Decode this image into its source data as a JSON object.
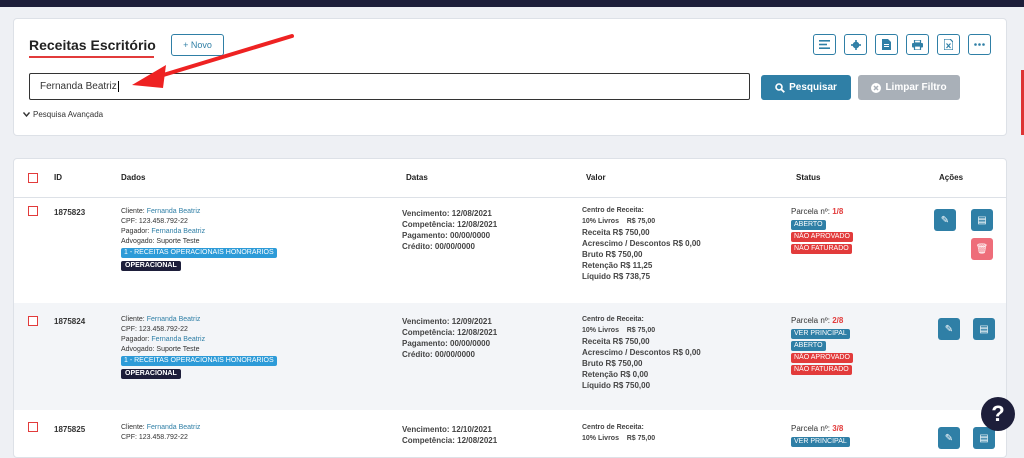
{
  "header": {
    "title": "Receitas Escritório",
    "new_button": "+ Novo",
    "toolbar_icons": [
      "list-icon",
      "gear-icon",
      "document-icon",
      "print-icon",
      "excel-icon",
      "more-icon"
    ]
  },
  "search": {
    "value": "Fernanda Beatriz",
    "search_button": "Pesquisar",
    "clear_button": "Limpar Filtro",
    "advanced_label": "Pesquisa Avançada"
  },
  "table": {
    "columns": {
      "id": "ID",
      "dados": "Dados",
      "datas": "Datas",
      "valor": "Valor",
      "status": "Status",
      "acoes": "Ações"
    },
    "rows": [
      {
        "id": "1875823",
        "cliente_label": "Cliente:",
        "cliente": "Fernanda Beatriz",
        "cpf": "CPF: 123.458.792-22",
        "pagador_label": "Pagador:",
        "pagador": "Fernanda Beatriz",
        "advogado": "Advogado: Suporte Teste",
        "categoria": "1 - RECEITAS OPERACIONAIS HONORARIOS",
        "tipo": "OPERACIONAL",
        "vencimento": "Vencimento: 12/08/2021",
        "competencia": "Competência: 12/08/2021",
        "pagamento": "Pagamento: 00/00/0000",
        "credito": "Crédito: 00/00/0000",
        "centro": "Centro de Receita:",
        "centro_item": "10% Livros    R$ 75,00",
        "receita": "Receita R$ 750,00",
        "acrescimo": "Acrescimo / Descontos R$ 0,00",
        "bruto": "Bruto R$ 750,00",
        "retencao": "Retenção R$ 11,25",
        "liquido": "Líquido R$ 738,75",
        "parcela_label": "Parcela nº:",
        "parcela": "1/8",
        "statuses": [
          "ABERTO",
          "NÃO APROVADO",
          "NÃO FATURADO"
        ]
      },
      {
        "id": "1875824",
        "cliente_label": "Cliente:",
        "cliente": "Fernanda Beatriz",
        "cpf": "CPF: 123.458.792-22",
        "pagador_label": "Pagador:",
        "pagador": "Fernanda Beatriz",
        "advogado": "Advogado: Suporte Teste",
        "categoria": "1 - RECEITAS OPERACIONAIS HONORARIOS",
        "tipo": "OPERACIONAL",
        "vencimento": "Vencimento: 12/09/2021",
        "competencia": "Competência: 12/08/2021",
        "pagamento": "Pagamento: 00/00/0000",
        "credito": "Crédito: 00/00/0000",
        "centro": "Centro de Receita:",
        "centro_item": "10% Livros    R$ 75,00",
        "receita": "Receita R$ 750,00",
        "acrescimo": "Acrescimo / Descontos R$ 0,00",
        "bruto": "Bruto R$ 750,00",
        "retencao": "Retenção R$ 0,00",
        "liquido": "Líquido R$ 750,00",
        "parcela_label": "Parcela nº:",
        "parcela": "2/8",
        "statuses": [
          "VER PRINCIPAL",
          "ABERTO",
          "NÃO APROVADO",
          "NÃO FATURADO"
        ]
      },
      {
        "id": "1875825",
        "cliente_label": "Cliente:",
        "cliente": "Fernanda Beatriz",
        "cpf": "CPF: 123.458.792-22",
        "vencimento": "Vencimento: 12/10/2021",
        "competencia": "Competência: 12/08/2021",
        "centro": "Centro de Receita:",
        "centro_item": "10% Livros    R$ 75,00",
        "parcela_label": "Parcela nº:",
        "parcela": "3/8",
        "statuses": [
          "VER PRINCIPAL"
        ]
      }
    ]
  },
  "help_label": "?"
}
